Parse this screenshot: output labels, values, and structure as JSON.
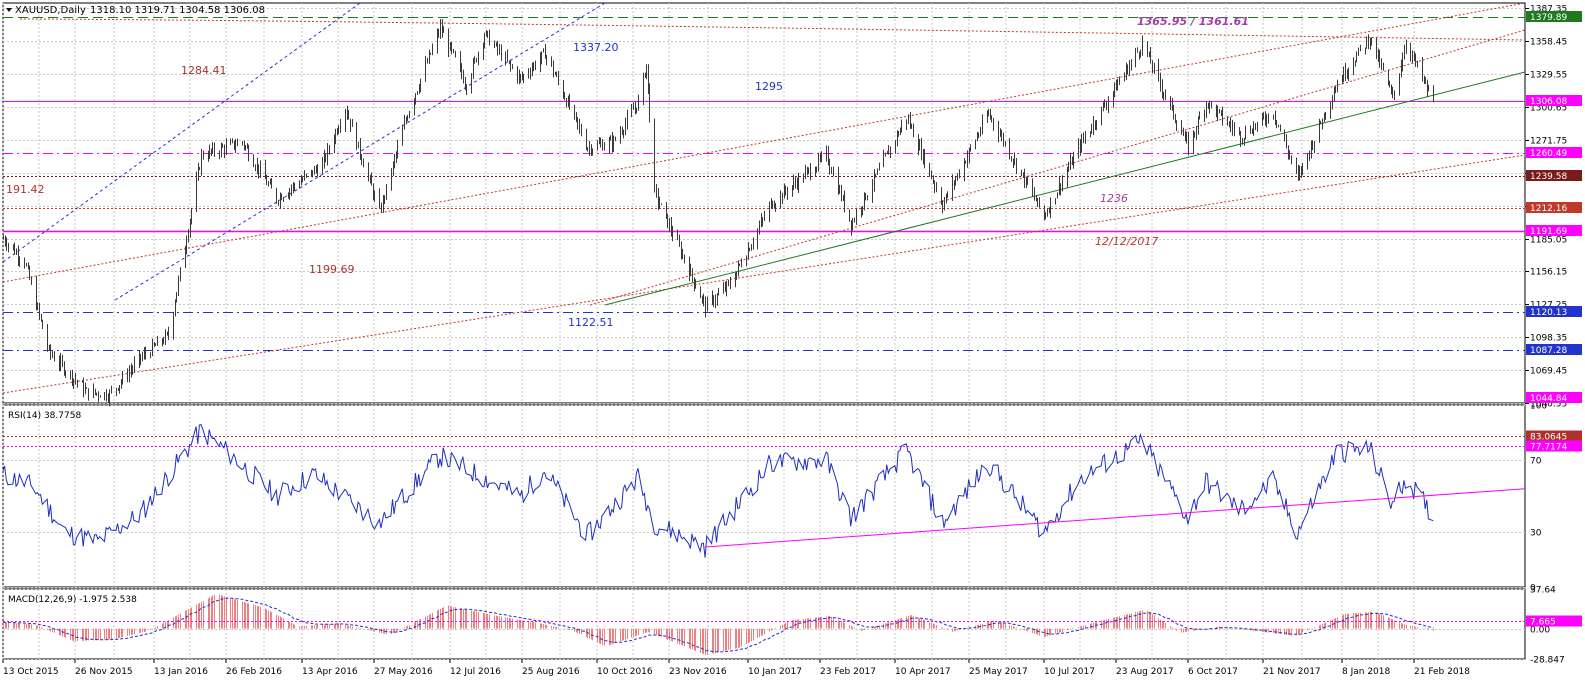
{
  "header": {
    "symbol_label": "XAUUSD,Daily",
    "ohlc_label": "1318.10 1319.71 1304.58 1306.08"
  },
  "colors": {
    "background": "#ffffff",
    "grid": "#c8c8c8",
    "price_candles": "#3a3a3a",
    "magenta_line": "#ff00ff",
    "red_tag": "#c0392b",
    "dark_red_tag": "#7a1b1b",
    "blue_tag": "#2233cc",
    "green_tag": "#1f7a1f",
    "rsi_line": "#1f2fbf",
    "macd_hist": "#f08080",
    "macd_signal": "#1f2fbf"
  },
  "x_axis": {
    "labels": [
      "13 Oct 2015",
      "26 Nov 2015",
      "13 Jan 2016",
      "26 Feb 2016",
      "13 Apr 2016",
      "27 May 2016",
      "12 Jul 2016",
      "25 Aug 2016",
      "10 Oct 2016",
      "23 Nov 2016",
      "10 Jan 2017",
      "23 Feb 2017",
      "10 Apr 2017",
      "25 May 2017",
      "10 Jul 2017",
      "23 Aug 2017",
      "6 Oct 2017",
      "21 Nov 2017",
      "8 Jan 2018",
      "21 Feb 2018"
    ]
  },
  "chart_data": [
    {
      "type": "line",
      "panel": "price",
      "ylim": [
        1040.5,
        1392
      ],
      "y_ticks": [
        1387.35,
        1358.45,
        1329.55,
        1300.65,
        1271.75,
        1242.85,
        1213.95,
        1185.05,
        1156.15,
        1127.25,
        1098.35,
        1069.45,
        1040.55
      ],
      "key_points": [
        {
          "date": "2015-10-13",
          "price": 1185
        },
        {
          "date": "2015-10-26",
          "price": 1165
        },
        {
          "date": "2015-11-10",
          "price": 1085
        },
        {
          "date": "2015-12-03",
          "price": 1050
        },
        {
          "date": "2015-12-17",
          "price": 1048
        },
        {
          "date": "2016-01-05",
          "price": 1080
        },
        {
          "date": "2016-01-22",
          "price": 1100
        },
        {
          "date": "2016-02-11",
          "price": 1258
        },
        {
          "date": "2016-03-07",
          "price": 1270
        },
        {
          "date": "2016-03-28",
          "price": 1220
        },
        {
          "date": "2016-04-25",
          "price": 1250
        },
        {
          "date": "2016-05-09",
          "price": 1300
        },
        {
          "date": "2016-05-30",
          "price": 1208
        },
        {
          "date": "2016-06-16",
          "price": 1295
        },
        {
          "date": "2016-07-06",
          "price": 1370
        },
        {
          "date": "2016-07-22",
          "price": 1320
        },
        {
          "date": "2016-08-02",
          "price": 1365
        },
        {
          "date": "2016-08-24",
          "price": 1325
        },
        {
          "date": "2016-09-08",
          "price": 1348
        },
        {
          "date": "2016-10-04",
          "price": 1265
        },
        {
          "date": "2016-10-20",
          "price": 1270
        },
        {
          "date": "2016-11-04",
          "price": 1305
        },
        {
          "date": "2016-11-09",
          "price": 1338
        },
        {
          "date": "2016-11-14",
          "price": 1225
        },
        {
          "date": "2016-12-15",
          "price": 1125
        },
        {
          "date": "2016-12-30",
          "price": 1145
        },
        {
          "date": "2017-01-24",
          "price": 1215
        },
        {
          "date": "2017-02-27",
          "price": 1258
        },
        {
          "date": "2017-03-14",
          "price": 1198
        },
        {
          "date": "2017-04-17",
          "price": 1292
        },
        {
          "date": "2017-05-09",
          "price": 1215
        },
        {
          "date": "2017-06-06",
          "price": 1295
        },
        {
          "date": "2017-07-10",
          "price": 1205
        },
        {
          "date": "2017-08-02",
          "price": 1270
        },
        {
          "date": "2017-09-08",
          "price": 1356
        },
        {
          "date": "2017-10-06",
          "price": 1265
        },
        {
          "date": "2017-10-17",
          "price": 1305
        },
        {
          "date": "2017-11-07",
          "price": 1275
        },
        {
          "date": "2017-11-27",
          "price": 1296
        },
        {
          "date": "2017-12-12",
          "price": 1238
        },
        {
          "date": "2018-01-05",
          "price": 1322
        },
        {
          "date": "2018-01-25",
          "price": 1362
        },
        {
          "date": "2018-02-08",
          "price": 1308
        },
        {
          "date": "2018-02-16",
          "price": 1358
        },
        {
          "date": "2018-03-01",
          "price": 1316
        },
        {
          "date": "2018-03-05",
          "price": 1306
        }
      ],
      "horizontal_levels": [
        {
          "price": 1379.89,
          "tag": "1379.89",
          "style": "dashed",
          "color": "#1f7a1f",
          "tag_bg": "#1f7a1f"
        },
        {
          "price": 1306.08,
          "tag": "1306.08",
          "style": "solid",
          "color": "#ff00ff",
          "tag_bg": "#ff00ff"
        },
        {
          "price": 1260.49,
          "tag": "1260.49",
          "style": "dashdot",
          "color": "#ff00ff",
          "tag_bg": "#ff00ff"
        },
        {
          "price": 1239.58,
          "tag": "1239.58",
          "style": "dotted",
          "color": "#7a1b1b",
          "tag_bg": "#7a1b1b"
        },
        {
          "price": 1212.16,
          "tag": "1212.16",
          "style": "dotted",
          "color": "#c0392b",
          "tag_bg": "#c0392b"
        },
        {
          "price": 1191.69,
          "tag": "1191.69",
          "style": "solid",
          "color": "#ff00ff",
          "tag_bg": "#ff00ff"
        },
        {
          "price": 1120.13,
          "tag": "1120.13",
          "style": "dashdot",
          "color": "#2233cc",
          "tag_bg": "#2233cc"
        },
        {
          "price": 1087.28,
          "tag": "1087.28",
          "style": "dashdot",
          "color": "#2233cc",
          "tag_bg": "#2233cc"
        },
        {
          "price": 1044.84,
          "tag": "1044.84",
          "style": "none",
          "color": "#ff00ff",
          "tag_bg": "#ff00ff"
        }
      ],
      "annotations": [
        {
          "text": "1284.41",
          "color": "#b03030",
          "italic": false
        },
        {
          "text": "191.42",
          "color": "#b03030",
          "italic": false
        },
        {
          "text": "1199.69",
          "color": "#b03030",
          "italic": false
        },
        {
          "text": "1337.20",
          "color": "#2233cc",
          "italic": false
        },
        {
          "text": "1295",
          "color": "#2233cc",
          "italic": false
        },
        {
          "text": "1122.51",
          "color": "#2233cc",
          "italic": false
        },
        {
          "text": "1365.95 / 1361.61",
          "color": "#a040a0",
          "italic": true
        },
        {
          "text": "1236",
          "color": "#a040a0",
          "italic": true
        },
        {
          "text": "12/12/2017",
          "color": "#c0392b",
          "italic": true
        }
      ]
    },
    {
      "type": "line",
      "panel": "rsi",
      "label": "RSI(14) 38.7758",
      "ylim": [
        0,
        100
      ],
      "y_ticks": [
        100,
        70,
        30,
        0
      ],
      "levels": [
        {
          "value": 83.0645,
          "tag": "83.0645",
          "color": "#b03030"
        },
        {
          "value": 77.7174,
          "tag": "77.7174",
          "color": "#ff00ff"
        }
      ],
      "key_points": [
        {
          "date": "2015-10-13",
          "value": 62
        },
        {
          "date": "2015-11-01",
          "value": 55
        },
        {
          "date": "2015-11-20",
          "value": 30
        },
        {
          "date": "2015-12-10",
          "value": 25
        },
        {
          "date": "2016-01-05",
          "value": 40
        },
        {
          "date": "2016-02-11",
          "value": 86
        },
        {
          "date": "2016-03-01",
          "value": 72
        },
        {
          "date": "2016-03-28",
          "value": 50
        },
        {
          "date": "2016-04-20",
          "value": 62
        },
        {
          "date": "2016-05-30",
          "value": 35
        },
        {
          "date": "2016-07-06",
          "value": 72
        },
        {
          "date": "2016-08-24",
          "value": 50
        },
        {
          "date": "2016-09-08",
          "value": 64
        },
        {
          "date": "2016-10-04",
          "value": 28
        },
        {
          "date": "2016-11-04",
          "value": 60
        },
        {
          "date": "2016-11-14",
          "value": 35
        },
        {
          "date": "2016-12-15",
          "value": 22
        },
        {
          "date": "2017-01-24",
          "value": 68
        },
        {
          "date": "2017-02-27",
          "value": 70
        },
        {
          "date": "2017-03-14",
          "value": 38
        },
        {
          "date": "2017-04-17",
          "value": 75
        },
        {
          "date": "2017-05-09",
          "value": 35
        },
        {
          "date": "2017-06-06",
          "value": 68
        },
        {
          "date": "2017-07-10",
          "value": 30
        },
        {
          "date": "2017-08-02",
          "value": 60
        },
        {
          "date": "2017-09-08",
          "value": 80
        },
        {
          "date": "2017-10-06",
          "value": 38
        },
        {
          "date": "2017-10-17",
          "value": 58
        },
        {
          "date": "2017-11-07",
          "value": 42
        },
        {
          "date": "2017-11-27",
          "value": 58
        },
        {
          "date": "2017-12-12",
          "value": 30
        },
        {
          "date": "2018-01-05",
          "value": 74
        },
        {
          "date": "2018-01-25",
          "value": 76
        },
        {
          "date": "2018-02-08",
          "value": 45
        },
        {
          "date": "2018-02-16",
          "value": 60
        },
        {
          "date": "2018-03-05",
          "value": 39
        }
      ],
      "trendline": {
        "from": {
          "date": "2016-12-15",
          "value": 22
        },
        "to": {
          "date": "2018-04-30",
          "value": 54
        }
      }
    },
    {
      "type": "bar",
      "panel": "macd",
      "label": "MACD(12,26,9) -1.975 2.538",
      "ylim": [
        -28.847,
        37.64
      ],
      "y_ticks": [
        37.64,
        7.665,
        0.0,
        -28.847
      ],
      "y_tick_labels": [
        "37.64",
        "7.665",
        "0.00",
        "-28.847"
      ],
      "level": {
        "value": 7.665,
        "tag": "7.665",
        "color": "#ff00ff"
      },
      "key_points": [
        {
          "date": "2015-10-13",
          "value": 6
        },
        {
          "date": "2015-11-01",
          "value": 4
        },
        {
          "date": "2015-11-25",
          "value": -12
        },
        {
          "date": "2015-12-20",
          "value": -10
        },
        {
          "date": "2016-01-10",
          "value": -2
        },
        {
          "date": "2016-02-20",
          "value": 33
        },
        {
          "date": "2016-03-20",
          "value": 20
        },
        {
          "date": "2016-04-10",
          "value": 2
        },
        {
          "date": "2016-05-05",
          "value": 5
        },
        {
          "date": "2016-06-05",
          "value": -6
        },
        {
          "date": "2016-07-10",
          "value": 22
        },
        {
          "date": "2016-08-10",
          "value": 12
        },
        {
          "date": "2016-09-05",
          "value": 5
        },
        {
          "date": "2016-09-25",
          "value": -2
        },
        {
          "date": "2016-10-15",
          "value": -17
        },
        {
          "date": "2016-11-10",
          "value": -3
        },
        {
          "date": "2016-12-15",
          "value": -25
        },
        {
          "date": "2017-01-05",
          "value": -18
        },
        {
          "date": "2017-02-05",
          "value": 8
        },
        {
          "date": "2017-03-01",
          "value": 12
        },
        {
          "date": "2017-03-20",
          "value": -2
        },
        {
          "date": "2017-04-20",
          "value": 13
        },
        {
          "date": "2017-05-15",
          "value": -3
        },
        {
          "date": "2017-06-10",
          "value": 8
        },
        {
          "date": "2017-07-10",
          "value": -8
        },
        {
          "date": "2017-08-10",
          "value": 6
        },
        {
          "date": "2017-09-10",
          "value": 18
        },
        {
          "date": "2017-10-01",
          "value": -4
        },
        {
          "date": "2017-10-25",
          "value": 2
        },
        {
          "date": "2017-11-15",
          "value": -2
        },
        {
          "date": "2017-12-10",
          "value": -7
        },
        {
          "date": "2018-01-10",
          "value": 14
        },
        {
          "date": "2018-01-28",
          "value": 16
        },
        {
          "date": "2018-02-15",
          "value": 4
        },
        {
          "date": "2018-03-05",
          "value": -2
        }
      ]
    }
  ]
}
